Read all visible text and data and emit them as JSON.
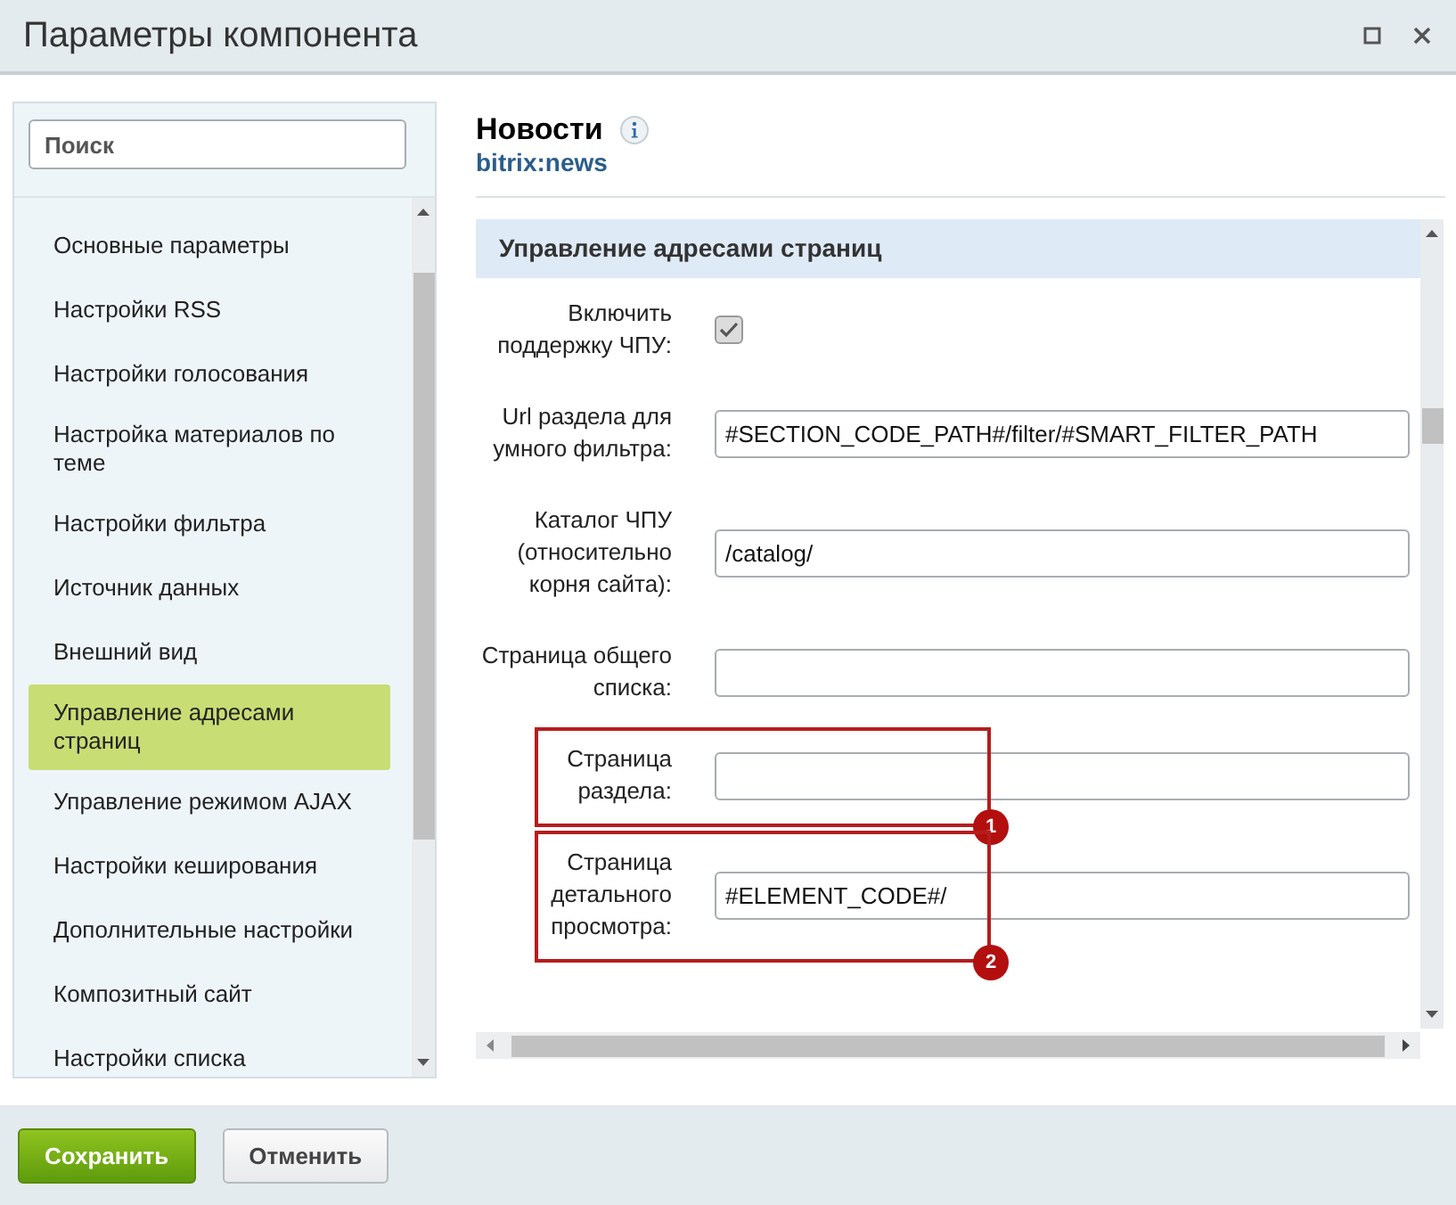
{
  "window": {
    "title": "Параметры компонента"
  },
  "search": {
    "placeholder": "Поиск"
  },
  "sidebar": {
    "items": [
      {
        "label": "Основные параметры",
        "selected": false
      },
      {
        "label": "Настройки RSS",
        "selected": false
      },
      {
        "label": "Настройки голосования",
        "selected": false
      },
      {
        "label": "Настройка материалов по теме",
        "selected": false
      },
      {
        "label": "Настройки фильтра",
        "selected": false
      },
      {
        "label": "Источник данных",
        "selected": false
      },
      {
        "label": "Внешний вид",
        "selected": false
      },
      {
        "label": "Управление адресами страниц",
        "selected": true
      },
      {
        "label": "Управление режимом AJAX",
        "selected": false
      },
      {
        "label": "Настройки кеширования",
        "selected": false
      },
      {
        "label": "Дополнительные настройки",
        "selected": false
      },
      {
        "label": "Композитный сайт",
        "selected": false
      },
      {
        "label": "Настройки списка",
        "selected": false
      }
    ]
  },
  "component": {
    "title": "Новости",
    "code": "bitrix:news"
  },
  "section": {
    "title": "Управление адресами страниц",
    "fields": [
      {
        "kind": "checkbox",
        "label": "Включить поддержку ЧПУ:",
        "checked": true
      },
      {
        "kind": "text",
        "label": "Url раздела для умного фильтра:",
        "value": "#SECTION_CODE_PATH#/filter/#SMART_FILTER_PATH"
      },
      {
        "kind": "text",
        "label": "Каталог ЧПУ (относительно корня сайта):",
        "value": "/catalog/"
      },
      {
        "kind": "text",
        "label": "Страница общего списка:"
      },
      {
        "kind": "text",
        "label": "Страница раздела:",
        "marker": "1"
      },
      {
        "kind": "text",
        "label": "Страница детального просмотра:",
        "value": "#ELEMENT_CODE#/",
        "marker": "2"
      }
    ]
  },
  "buttons": [
    {
      "label": "Сохранить",
      "kind": "primary"
    },
    {
      "label": "Отменить",
      "kind": "secondary"
    }
  ]
}
